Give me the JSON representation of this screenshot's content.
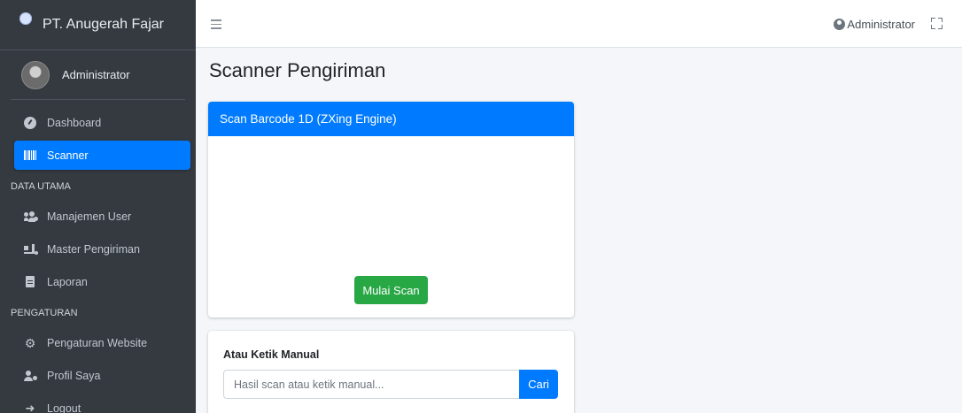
{
  "brand": {
    "name": "PT. Anugerah Fajar"
  },
  "user_panel": {
    "name": "Administrator"
  },
  "sidebar": {
    "items": [
      {
        "label": "Dashboard",
        "icon": "tachometer-icon"
      },
      {
        "label": "Scanner",
        "icon": "barcode-icon",
        "active": true
      },
      {
        "header": "DATA UTAMA"
      },
      {
        "label": "Manajemen User",
        "icon": "users-cog-icon"
      },
      {
        "label": "Master Pengiriman",
        "icon": "truck-loading-icon"
      },
      {
        "label": "Laporan",
        "icon": "file-icon"
      },
      {
        "header": "PENGATURAN"
      },
      {
        "label": "Pengaturan Website",
        "icon": "cogs-icon"
      },
      {
        "label": "Profil Saya",
        "icon": "user-cog-icon"
      },
      {
        "label": "Logout",
        "icon": "sign-out-icon"
      }
    ]
  },
  "topbar": {
    "user_label": "Administrator"
  },
  "page": {
    "title": "Scanner Pengiriman"
  },
  "scan_card": {
    "header": "Scan Barcode 1D (ZXing Engine)",
    "button_label": "Mulai Scan"
  },
  "manual_card": {
    "label": "Atau Ketik Manual",
    "placeholder": "Hasil scan atau ketik manual...",
    "value": "",
    "button_label": "Cari"
  },
  "colors": {
    "primary": "#007bff",
    "success": "#28a745",
    "sidebar_bg": "#343a40",
    "content_bg": "#f4f6f9"
  }
}
